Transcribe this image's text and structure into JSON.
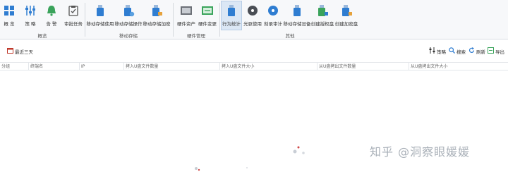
{
  "ribbon": {
    "buttons": [
      {
        "id": "overview",
        "label": "概 览",
        "icon": "dashboard-icon"
      },
      {
        "id": "strategy",
        "label": "策 略",
        "icon": "sliders-icon"
      },
      {
        "id": "alert",
        "label": "告 警",
        "icon": "bell-icon"
      },
      {
        "id": "audit-task",
        "label": "审批任务",
        "icon": "clipboard-check-icon"
      },
      {
        "id": "usb-usage",
        "label": "移动存储使用",
        "icon": "usb-drive-icon"
      },
      {
        "id": "usb-operation",
        "label": "移动存储操作",
        "icon": "usb-drive-icon"
      },
      {
        "id": "usb-encrypt",
        "label": "移动存储加密",
        "icon": "usb-lock-icon"
      },
      {
        "id": "hardware-asset",
        "label": "硬件资产",
        "icon": "hardware-icon"
      },
      {
        "id": "hardware-change",
        "label": "硬件变更",
        "icon": "hardware-change-icon"
      },
      {
        "id": "behavior-stats",
        "label": "行为统计",
        "icon": "usb-stats-icon"
      },
      {
        "id": "cd-usage",
        "label": "光驱使用",
        "icon": "disc-icon"
      },
      {
        "id": "burn-audit",
        "label": "刻录审计",
        "icon": "burn-disc-icon"
      },
      {
        "id": "usb-device",
        "label": "移动存储设备",
        "icon": "usb-drive-icon"
      },
      {
        "id": "create-auth",
        "label": "创建授权盘",
        "icon": "usb-plus-icon"
      },
      {
        "id": "create-encrypt",
        "label": "创建加密盘",
        "icon": "usb-key-icon"
      }
    ],
    "groups": [
      {
        "id": "overview-group",
        "label": "概览"
      },
      {
        "id": "usb-group",
        "label": "移动存储"
      },
      {
        "id": "hardware-group",
        "label": "硬件管理"
      },
      {
        "id": "other-group",
        "label": "其他"
      }
    ]
  },
  "toolbar": {
    "date_range": "最近三天",
    "actions": [
      "策略",
      "搜索",
      "刷新",
      "导出"
    ]
  },
  "table": {
    "columns": [
      "分组",
      "终端名",
      "IP",
      "拷入U盘文件数量",
      "拷入U盘文件大小",
      "从U盘拷出文件数量",
      "从U盘拷出文件大小"
    ]
  },
  "watermark": "知乎 @洞察眼媛媛",
  "colors": {
    "accent_blue": "#2f7dd1",
    "green": "#3aa35b",
    "active_bg": "#dbe7f5"
  }
}
